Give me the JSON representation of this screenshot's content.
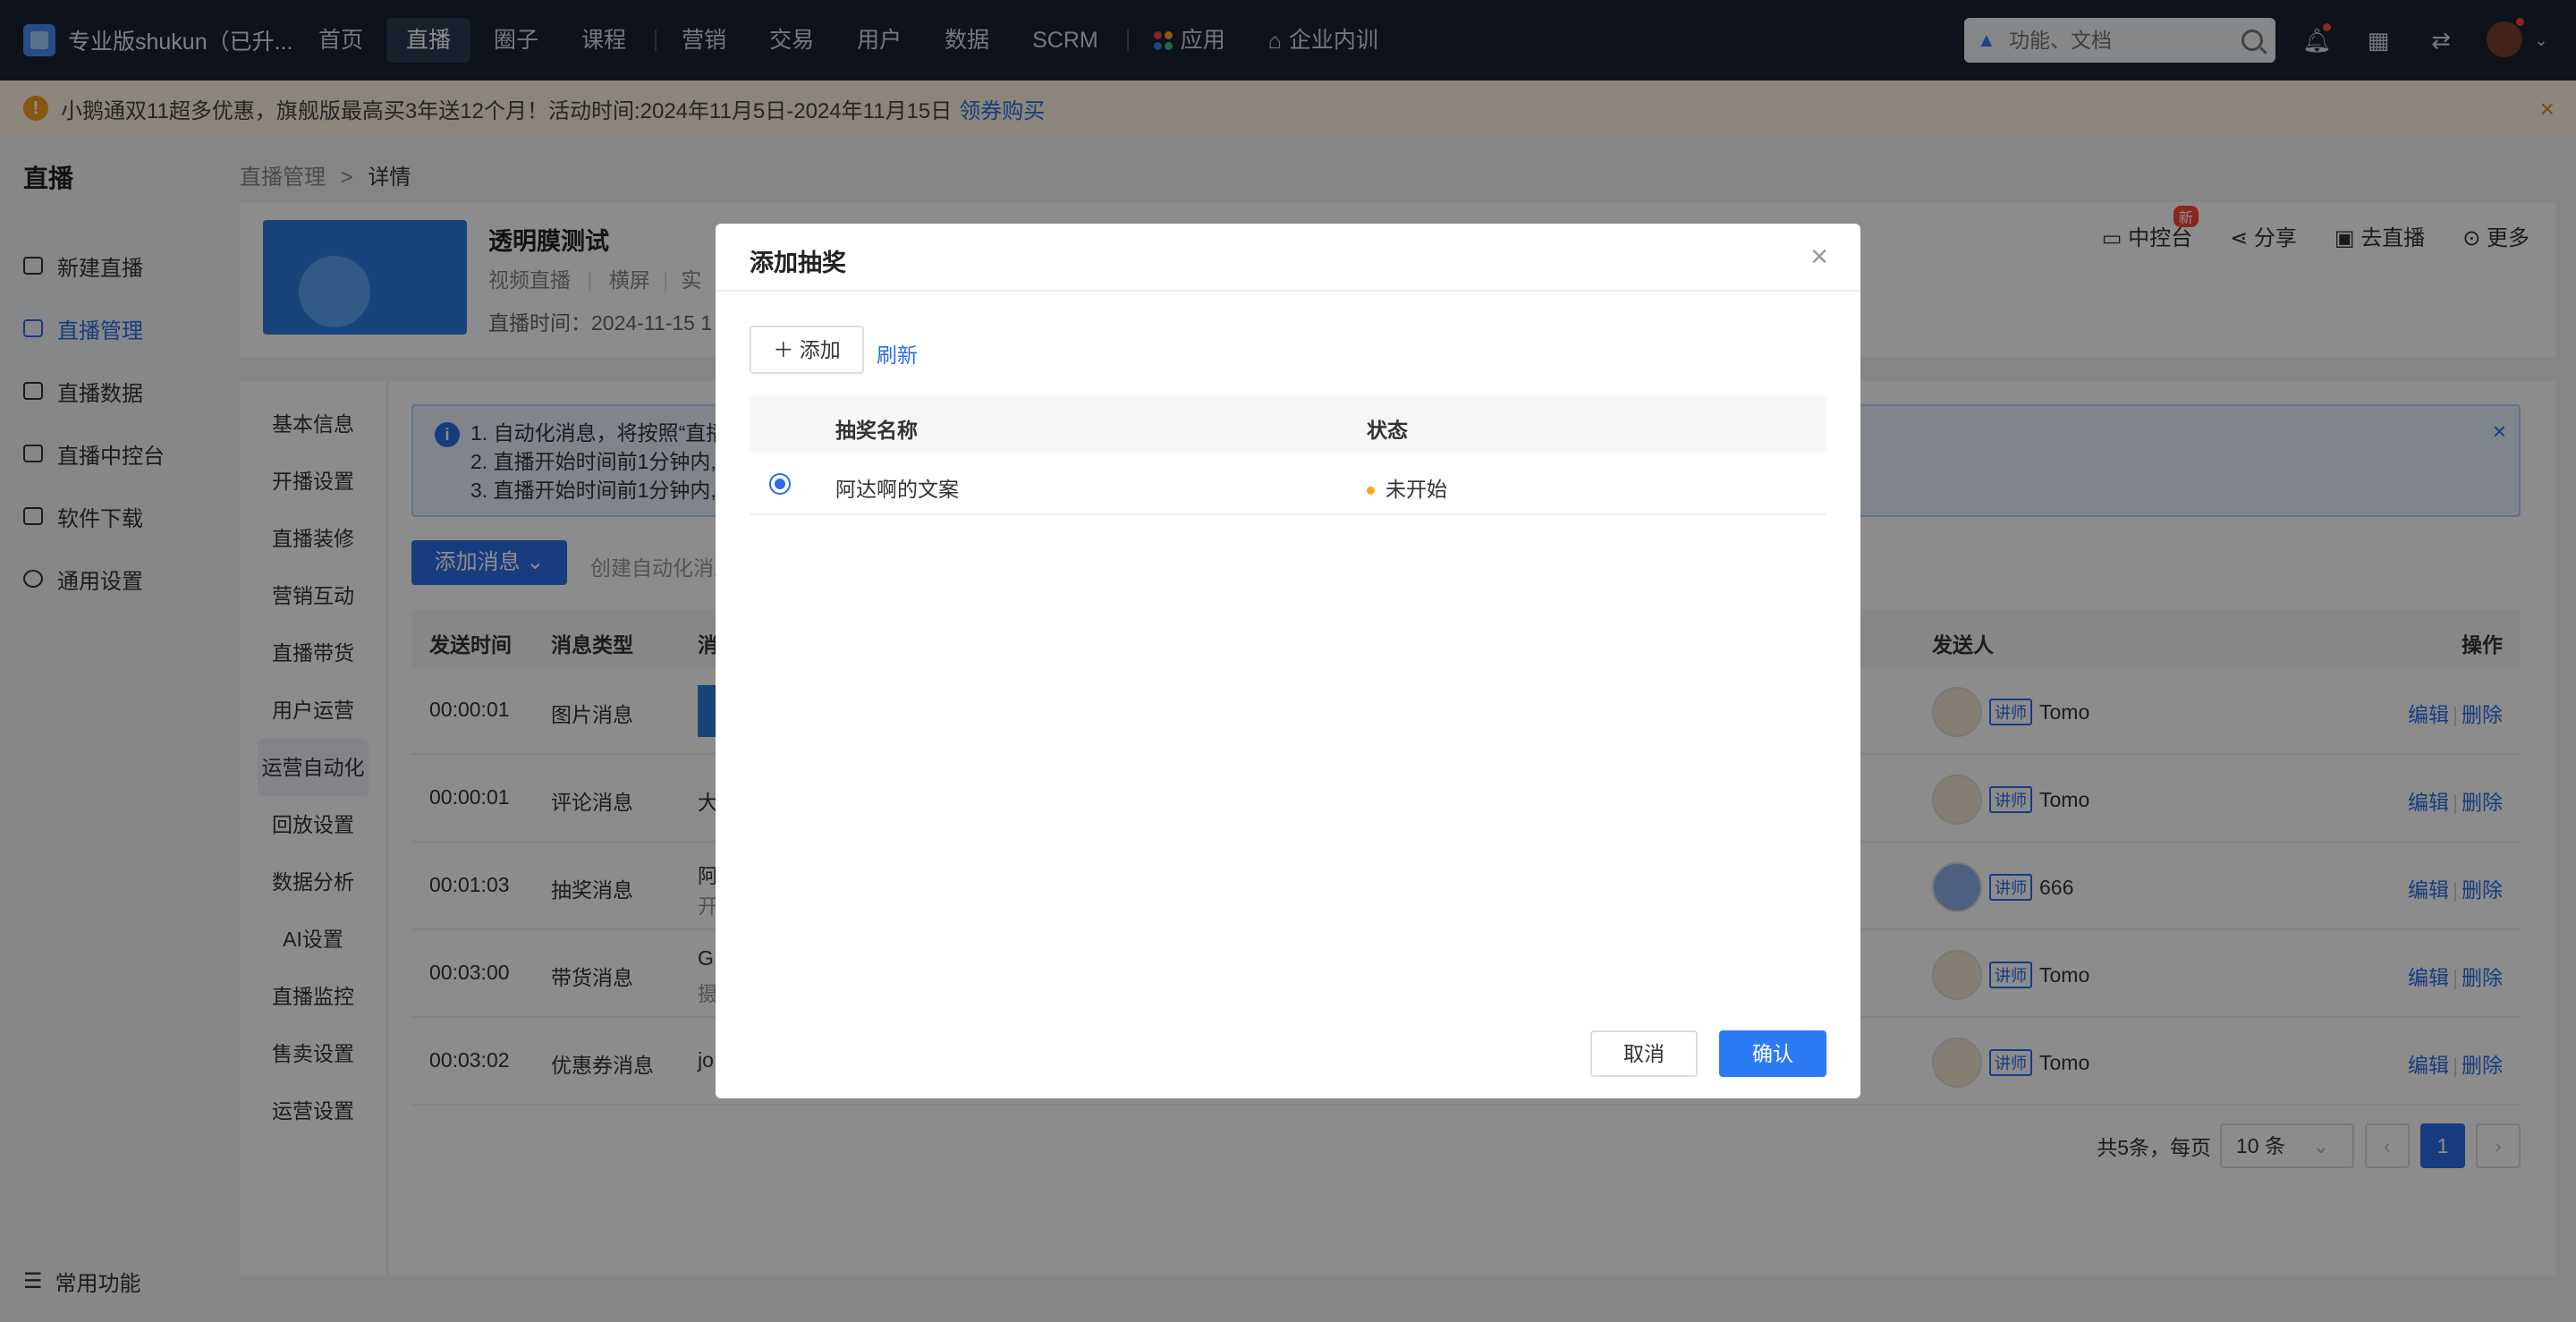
{
  "app": {
    "title": "专业版shukun（已升..."
  },
  "topnav": {
    "items": [
      "首页",
      "直播",
      "圈子",
      "课程",
      "营销",
      "交易",
      "用户",
      "数据",
      "SCRM",
      "应用",
      "企业内训"
    ],
    "active_index": 1,
    "search_placeholder": "功能、文档"
  },
  "notice": {
    "text": "小鹅通双11超多优惠，旗舰版最高买3年送12个月！活动时间:2024年11月5日-2024年11月15日",
    "link": "领券购买",
    "color": "#fdf3e0"
  },
  "sidebar": {
    "title": "直播",
    "items": [
      "新建直播",
      "直播管理",
      "直播数据",
      "直播中控台",
      "软件下载",
      "通用设置"
    ],
    "active_index": 1,
    "bottom": "常用功能"
  },
  "breadcrumb": {
    "parent": "直播管理",
    "sep": ">",
    "current": "详情"
  },
  "live": {
    "title": "透明膜测试",
    "type": "视频直播",
    "orientation": "横屏",
    "extra": "实",
    "time": "直播时间：2024-11-15 1",
    "actions": [
      "中控台",
      "分享",
      "去直播",
      "更多"
    ],
    "new_badge": "新"
  },
  "subnav": {
    "items": [
      "基本信息",
      "开播设置",
      "直播装修",
      "营销互动",
      "直播带货",
      "用户运营",
      "运营自动化",
      "回放设置",
      "数据分析",
      "AI设置",
      "直播监控",
      "售卖设置",
      "运营设置"
    ],
    "active_index": 6
  },
  "info": {
    "lines": [
      "1. 自动化消息，将按照“直播",
      "2. 直播开始时间前1分钟内,",
      "3. 直播开始时间前1分钟内,"
    ]
  },
  "toolbar": {
    "add_message": "添加消息",
    "create_auto": "创建自动化消息"
  },
  "table": {
    "headers": {
      "time": "发送时间",
      "type": "消息类型",
      "content": "消",
      "sender": "发送人",
      "ops": "操作"
    },
    "teacher_tag": "讲师",
    "edit": "编辑",
    "delete": "删除",
    "rows": [
      {
        "time": "00:00:01",
        "type": "图片消息",
        "content": "",
        "sub": "",
        "sender": "Tomo"
      },
      {
        "time": "00:00:01",
        "type": "评论消息",
        "content": "大",
        "sub": "",
        "sender": "Tomo"
      },
      {
        "time": "00:01:03",
        "type": "抽奖消息",
        "content": "阿",
        "sub": "开",
        "sender": "666"
      },
      {
        "time": "00:03:00",
        "type": "带货消息",
        "content": "G",
        "sub": "摄",
        "sender": "Tomo"
      },
      {
        "time": "00:03:02",
        "type": "优惠券消息",
        "content": "jo",
        "sub": "",
        "sender": "Tomo"
      }
    ]
  },
  "pager": {
    "total": "共5条，每页",
    "page_size": "10 条",
    "current": "1"
  },
  "modal": {
    "title": "添加抽奖",
    "add": "添加",
    "refresh": "刷新",
    "headers": {
      "name": "抽奖名称",
      "status": "状态"
    },
    "rows": [
      {
        "name": "阿达啊的文案",
        "status": "未开始"
      }
    ],
    "cancel": "取消",
    "confirm": "确认",
    "accent": "#2b7bf5"
  }
}
